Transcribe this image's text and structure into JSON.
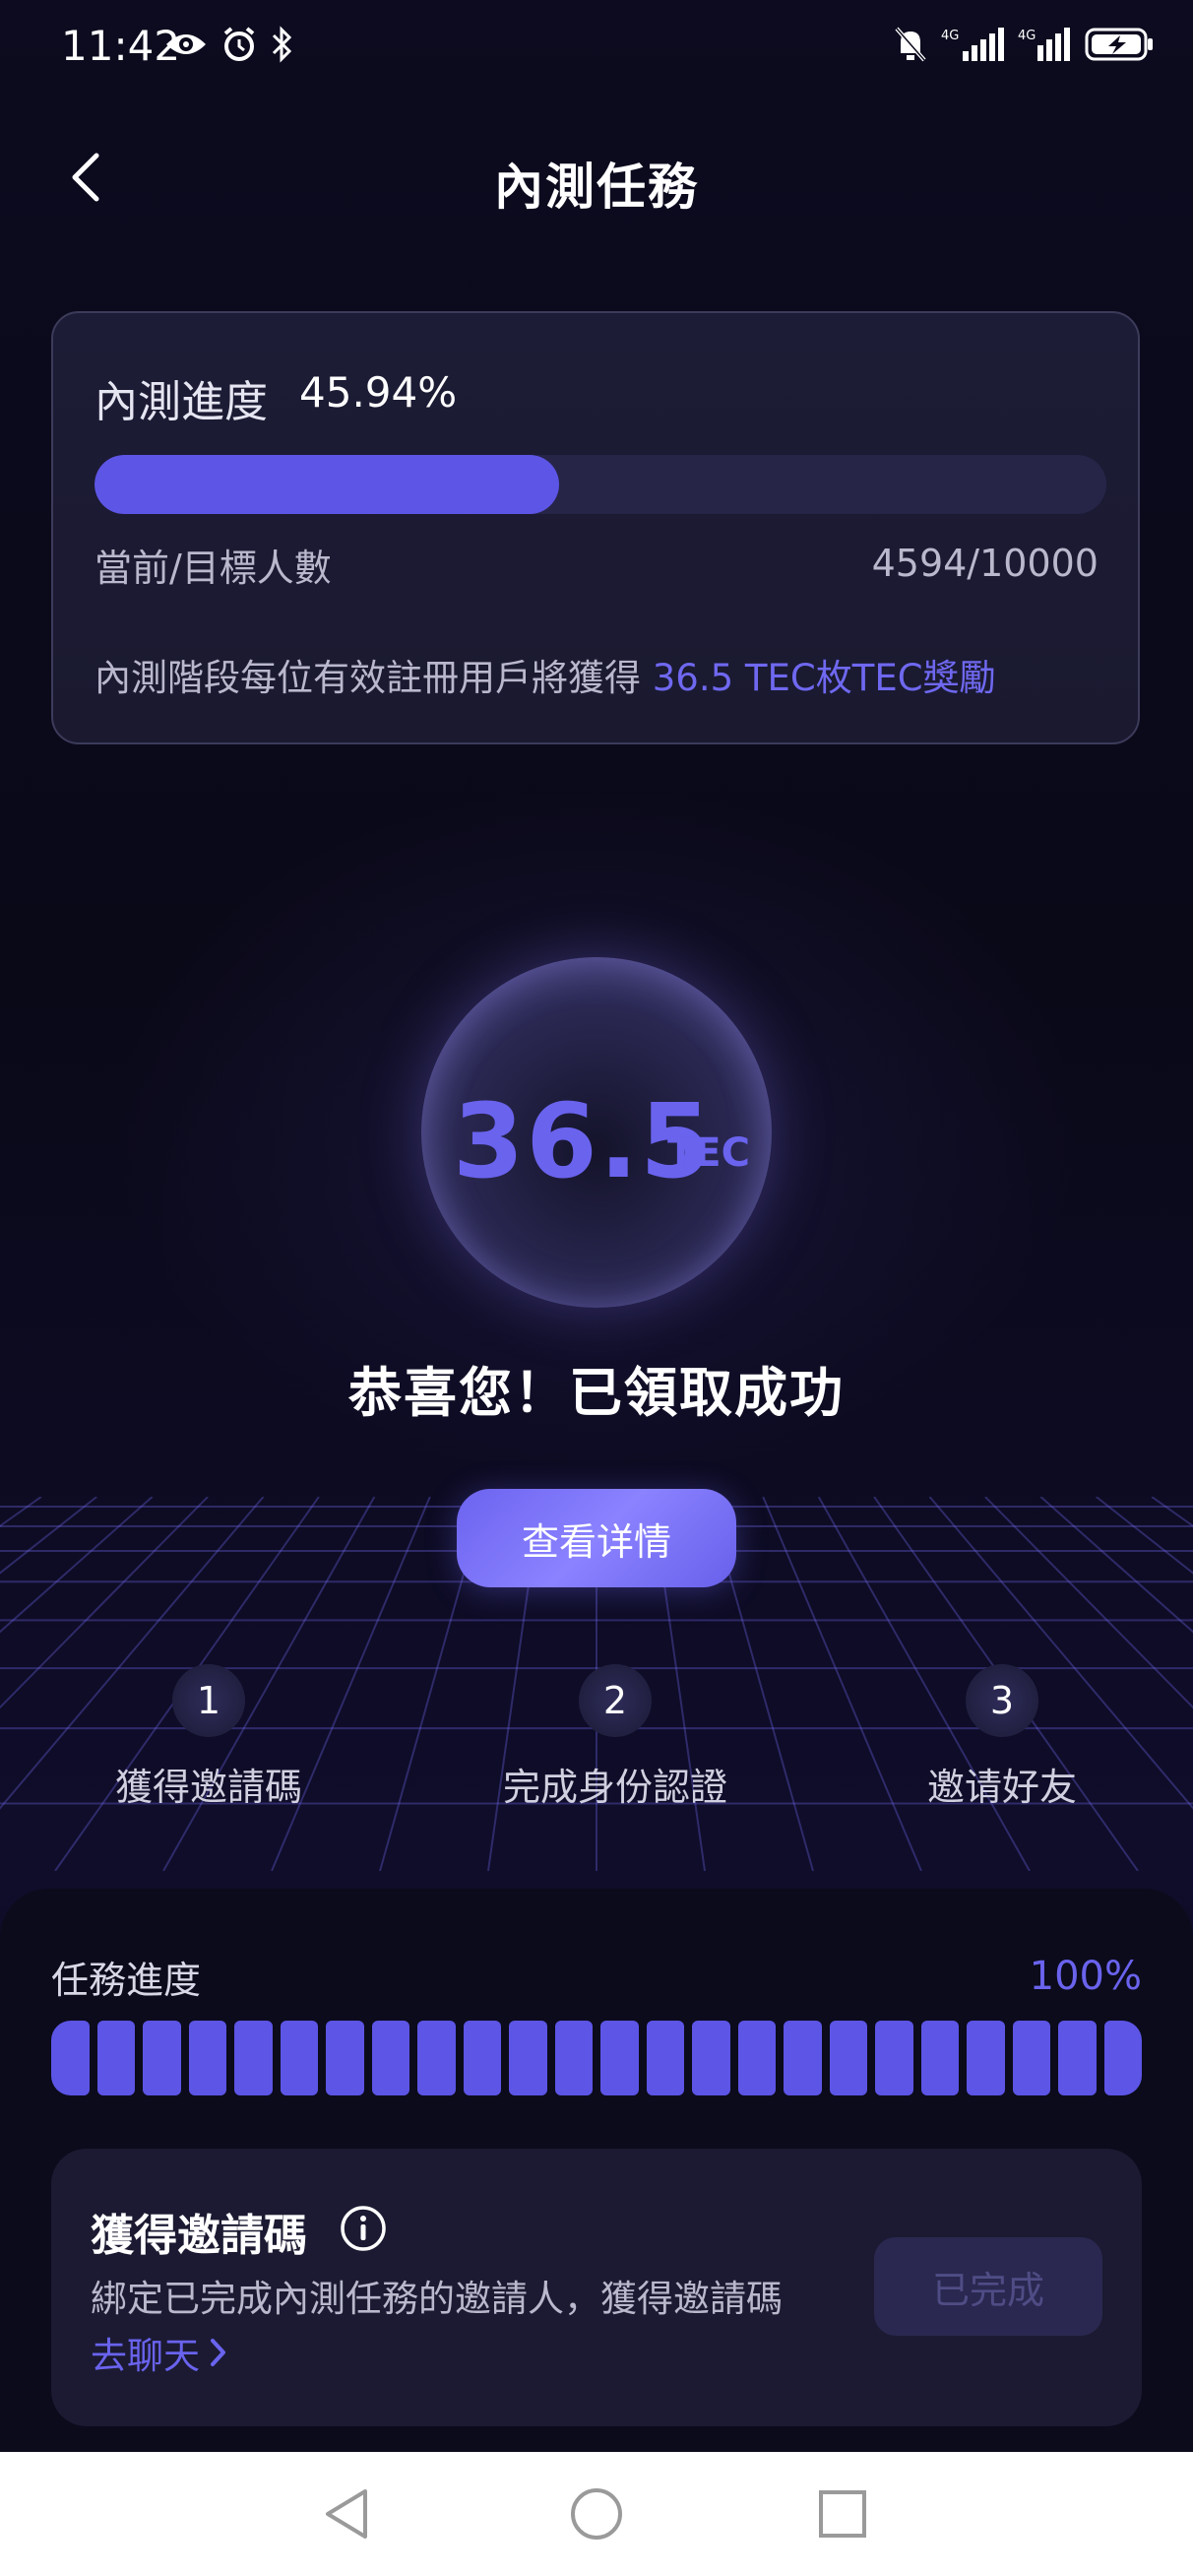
{
  "status_bar": {
    "time": "11:42",
    "left_icons": [
      "eye-icon",
      "alarm-icon",
      "bluetooth-icon"
    ],
    "right_icons": [
      "mute-icon",
      "signal-4g-icon",
      "signal-4g-icon",
      "battery-charging-icon"
    ]
  },
  "header": {
    "title": "內測任務"
  },
  "beta_progress": {
    "label": "內測進度",
    "percent_text": "45.94%",
    "fraction": 0.4594,
    "count_label": "當前/目標人數",
    "count_value": "4594/10000",
    "note_prefix": "內測階段每位有效註冊用戶將獲得 ",
    "note_highlight": "36.5 TEC枚TEC獎勵"
  },
  "reward": {
    "amount": "36.5",
    "unit": "TEC",
    "message": "恭喜您！已領取成功",
    "detail_button": "查看详情"
  },
  "steps": [
    {
      "number": "1",
      "label": "獲得邀請碼"
    },
    {
      "number": "2",
      "label": "完成身份認證"
    },
    {
      "number": "3",
      "label": "邀请好友"
    }
  ],
  "task_progress": {
    "label": "任務進度",
    "value_text": "100%",
    "fraction": 1.0
  },
  "task_card": {
    "title": "獲得邀請碼",
    "description": "綁定已完成內測任務的邀請人，獲得邀請碼",
    "link": "去聊天",
    "status_button": "已完成"
  },
  "colors": {
    "accent": "#5d55e6",
    "accent_text": "#6a63ee",
    "background": "#0b0a1c"
  }
}
